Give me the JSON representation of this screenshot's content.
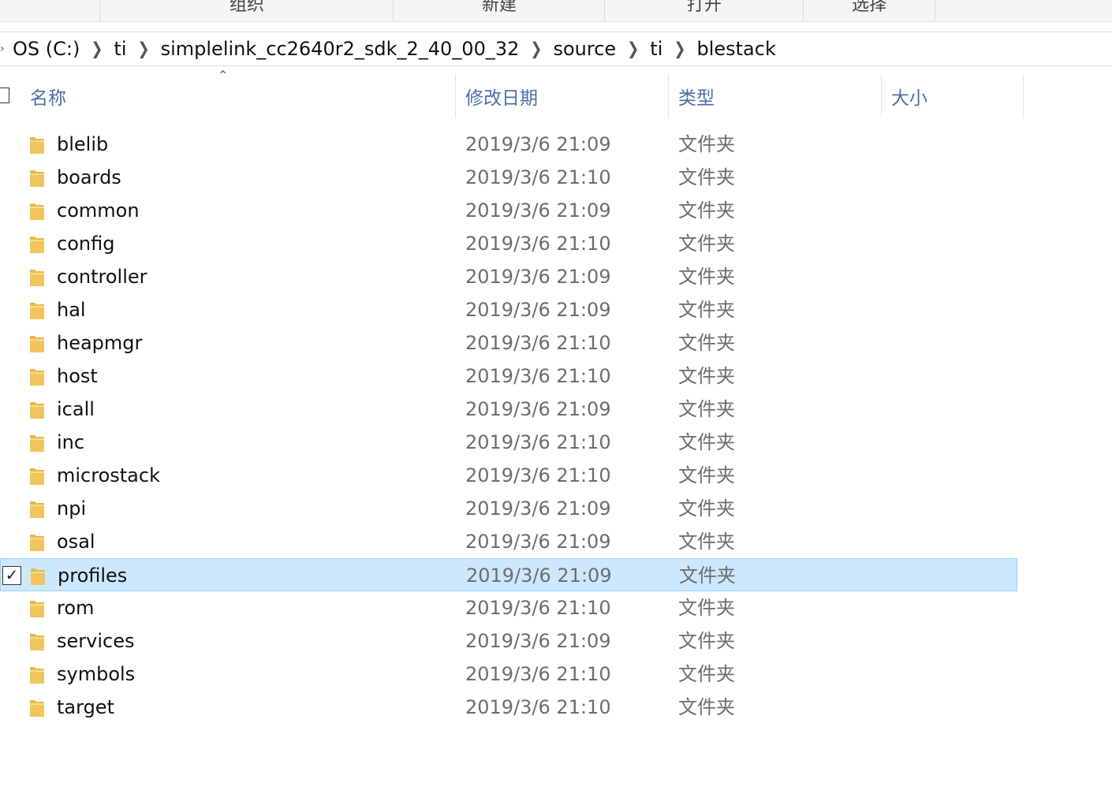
{
  "ribbon": {
    "groups": [
      "组织",
      "新建",
      "打开",
      "选择"
    ]
  },
  "address": {
    "crumbs": [
      "OS (C:)",
      "ti",
      "simplelink_cc2640r2_sdk_2_40_00_32",
      "source",
      "ti",
      "blestack"
    ]
  },
  "columns": {
    "name": "名称",
    "date": "修改日期",
    "type": "类型",
    "size": "大小"
  },
  "rows": [
    {
      "name": "blelib",
      "date": "2019/3/6 21:09",
      "type": "文件夹",
      "size": "",
      "selected": false
    },
    {
      "name": "boards",
      "date": "2019/3/6 21:10",
      "type": "文件夹",
      "size": "",
      "selected": false
    },
    {
      "name": "common",
      "date": "2019/3/6 21:09",
      "type": "文件夹",
      "size": "",
      "selected": false
    },
    {
      "name": "config",
      "date": "2019/3/6 21:10",
      "type": "文件夹",
      "size": "",
      "selected": false
    },
    {
      "name": "controller",
      "date": "2019/3/6 21:09",
      "type": "文件夹",
      "size": "",
      "selected": false
    },
    {
      "name": "hal",
      "date": "2019/3/6 21:09",
      "type": "文件夹",
      "size": "",
      "selected": false
    },
    {
      "name": "heapmgr",
      "date": "2019/3/6 21:10",
      "type": "文件夹",
      "size": "",
      "selected": false
    },
    {
      "name": "host",
      "date": "2019/3/6 21:10",
      "type": "文件夹",
      "size": "",
      "selected": false
    },
    {
      "name": "icall",
      "date": "2019/3/6 21:09",
      "type": "文件夹",
      "size": "",
      "selected": false
    },
    {
      "name": "inc",
      "date": "2019/3/6 21:10",
      "type": "文件夹",
      "size": "",
      "selected": false
    },
    {
      "name": "microstack",
      "date": "2019/3/6 21:10",
      "type": "文件夹",
      "size": "",
      "selected": false
    },
    {
      "name": "npi",
      "date": "2019/3/6 21:09",
      "type": "文件夹",
      "size": "",
      "selected": false
    },
    {
      "name": "osal",
      "date": "2019/3/6 21:09",
      "type": "文件夹",
      "size": "",
      "selected": false
    },
    {
      "name": "profiles",
      "date": "2019/3/6 21:09",
      "type": "文件夹",
      "size": "",
      "selected": true
    },
    {
      "name": "rom",
      "date": "2019/3/6 21:10",
      "type": "文件夹",
      "size": "",
      "selected": false
    },
    {
      "name": "services",
      "date": "2019/3/6 21:09",
      "type": "文件夹",
      "size": "",
      "selected": false
    },
    {
      "name": "symbols",
      "date": "2019/3/6 21:10",
      "type": "文件夹",
      "size": "",
      "selected": false
    },
    {
      "name": "target",
      "date": "2019/3/6 21:10",
      "type": "文件夹",
      "size": "",
      "selected": false
    }
  ],
  "icons": {
    "folder": "folder-icon",
    "breadcrumb_separator": "chevron-right-icon",
    "sort": "sort-ascending-icon",
    "checkbox": "checkbox-icon"
  },
  "colors": {
    "selection_bg": "#cce8ff",
    "selection_border": "#99d1ff",
    "header_text": "#4a6fa5",
    "folder": "#f2c55c"
  }
}
